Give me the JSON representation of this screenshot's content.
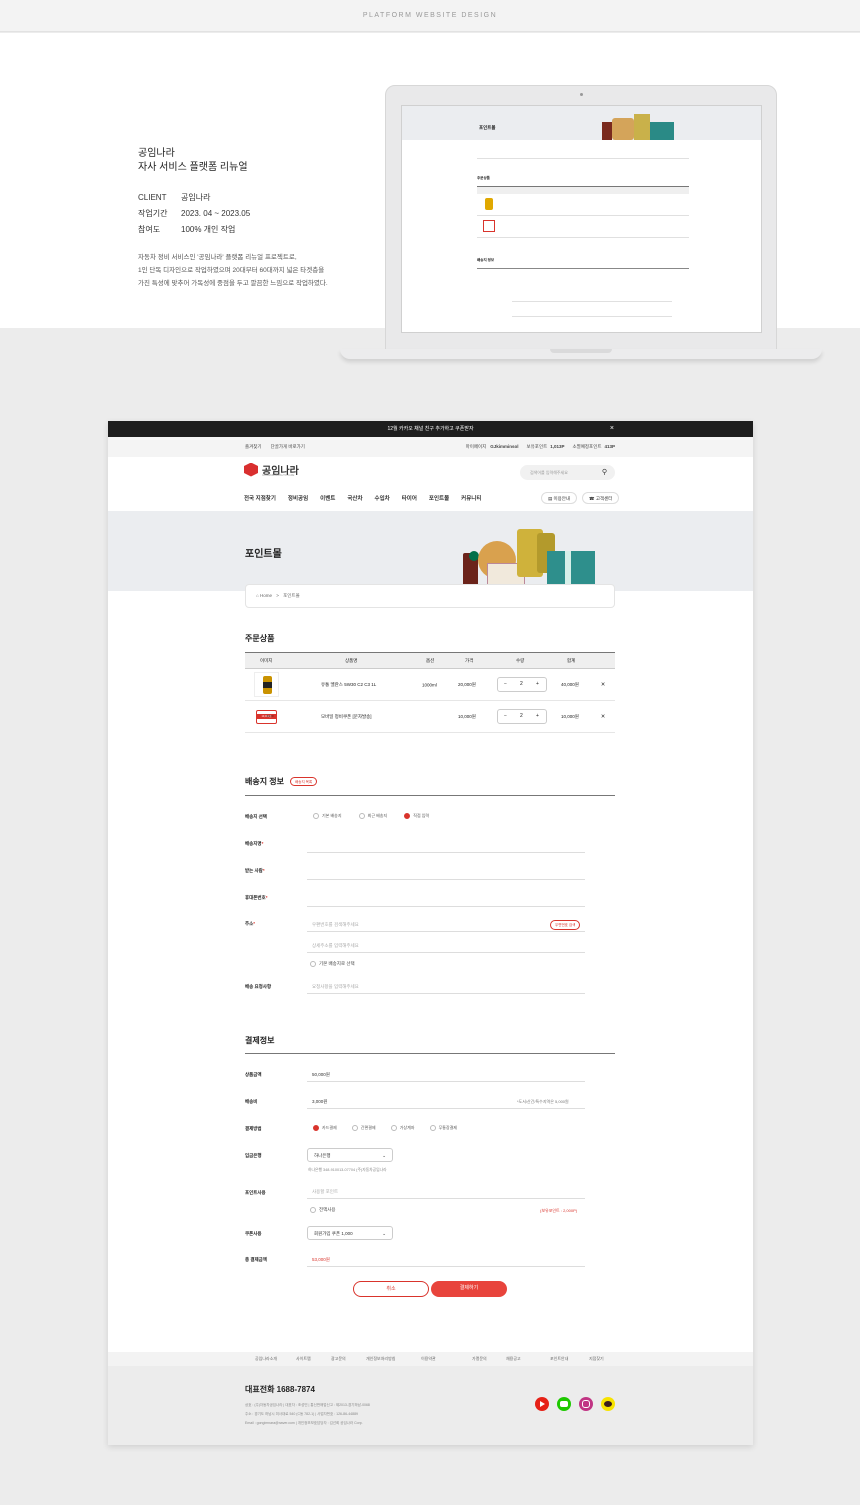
{
  "header_strip": "PLATFORM WEBSITE DESIGN",
  "intro": {
    "title_line1": "공임나라",
    "title_line2": "자사 서비스 플랫폼 리뉴얼",
    "rows": [
      {
        "k": "CLIENT",
        "v": "공임나라"
      },
      {
        "k": "작업기간",
        "v": "2023. 04 ~ 2023.05"
      },
      {
        "k": "참여도",
        "v": "100% 개인 작업"
      }
    ],
    "desc1": "자동차 정비 서비스인 '공임나라' 플랫폼 리뉴얼 프로젝트로,",
    "desc2": "1인 단독 디자인으로 작업하였으며 20대부터 60대까지 넓은 타겟층을",
    "desc3": "가진 특성에 맞추어 가독성에 중점을 두고 깔끔한 느낌으로 작업하였다."
  },
  "mini": {
    "title": "포인트몰",
    "order": "주문상품",
    "ship": "배송지 정보"
  },
  "notice": {
    "text": "12월 카카오 채널 친구 추가하고 쿠폰받자",
    "close": "×"
  },
  "util": {
    "left": [
      "즐겨찾기",
      "단골가게 바로가기"
    ],
    "user": "마이페이지",
    "id": "GJkimminsol",
    "points_label": "보유포인트",
    "points": "1,013P",
    "expire_label": "소멸예정포인트",
    "expire": "413P"
  },
  "brand": {
    "name": "공임나라",
    "sub": "GONGIMNARA AUTO CARE"
  },
  "search": {
    "placeholder": "검색어를 입력해주세요"
  },
  "gnb": [
    "전국 지점찾기",
    "정비공임",
    "이벤트",
    "국산차",
    "수입차",
    "타이어",
    "포인트몰",
    "커뮤니티"
  ],
  "gnb_btns": [
    "이용안내",
    "고객센터"
  ],
  "banner": {
    "title": "포인트몰"
  },
  "breadcrumb": {
    "home": "Home",
    "sep": ">",
    "current": "포인트몰"
  },
  "order": {
    "title": "주문상품",
    "headers": [
      "이미지",
      "상품명",
      "옵션",
      "가격",
      "수량",
      "합계"
    ],
    "rows": [
      {
        "name": "유통 엘란스 5W30 C2 C3 1L",
        "option": "1000ml",
        "price": "20,000원",
        "qty": "2",
        "total": "40,000원"
      },
      {
        "name": "모바일 정비쿠폰 [문자발송]",
        "option": "",
        "price": "10,000원",
        "qty": "2",
        "total": "10,000원"
      }
    ],
    "coupon_top": "정비쿠폰",
    "coupon_price": "10,000원"
  },
  "shipping": {
    "title": "배송지 정보",
    "change": "배송지 목록",
    "select_label": "배송지 선택",
    "options": [
      "기본 배송지",
      "최근 배송지",
      "직접 입력"
    ],
    "name_label": "배송지명",
    "recv_label": "받는 사람",
    "phone_label": "휴대폰번호",
    "addr_label": "주소",
    "addr_ph": "우편번호를 검색해주세요",
    "addr_btn": "우편번호 검색",
    "addr2_ph": "상세주소를 입력해주세요",
    "default_chk": "기본 배송지로 선택",
    "req_label": "배송 요청사항",
    "req_ph": "요청사항을 입력해주세요"
  },
  "payment": {
    "title": "결제정보",
    "amount_label": "상품금액",
    "amount": "50,000원",
    "fee_label": "배송비",
    "fee": "3,000원",
    "fee_note": "*도서/산간/특수지역은 5,000원",
    "method_label": "결제방법",
    "methods": [
      "카드결제",
      "간편결제",
      "가상계좌",
      "무통장결제"
    ],
    "bank_label": "입금은행",
    "bank": "하나은행",
    "bank_info": "하나은행 348-910013-07704 (주)자동차공임나라",
    "point_label": "포인트사용",
    "point_ph": "사용할 포인트",
    "point_all": "전액사용",
    "point_note": "(보유포인트 : 2,000P)",
    "coupon_label": "쿠폰사용",
    "coupon": "회원가입 쿠폰 1,000",
    "total_label": "총 결제금액",
    "total": "53,000원"
  },
  "buttons": {
    "cancel": "취소",
    "pay": "결제하기"
  },
  "footer": {
    "nav": [
      "공임나라소개",
      "사이트맵",
      "광고문의",
      "개인정보처리방침",
      "이용약관",
      "가맹문의",
      "채용공고",
      "포인트안내",
      "지점찾기"
    ],
    "tel": "대표전화  1688-7874",
    "info1": "상호 : (주)자동차공임나라   |   대표자 : 조성민   |   통신판매업신고 : 제2013-경기하남-0068",
    "info2": "주소 : 경기도 하남시 미사대로 540 (C동 782-1)   |   사업자번호 : 126-86-44889",
    "info3": "Email : gongimnara@naver.com   |   개인정보보호담당자 : 김선희 공임나라 Corp."
  },
  "colors": {
    "accent": "#d9342c",
    "dark": "#1d1d1d",
    "banner": "#ebedf0"
  }
}
